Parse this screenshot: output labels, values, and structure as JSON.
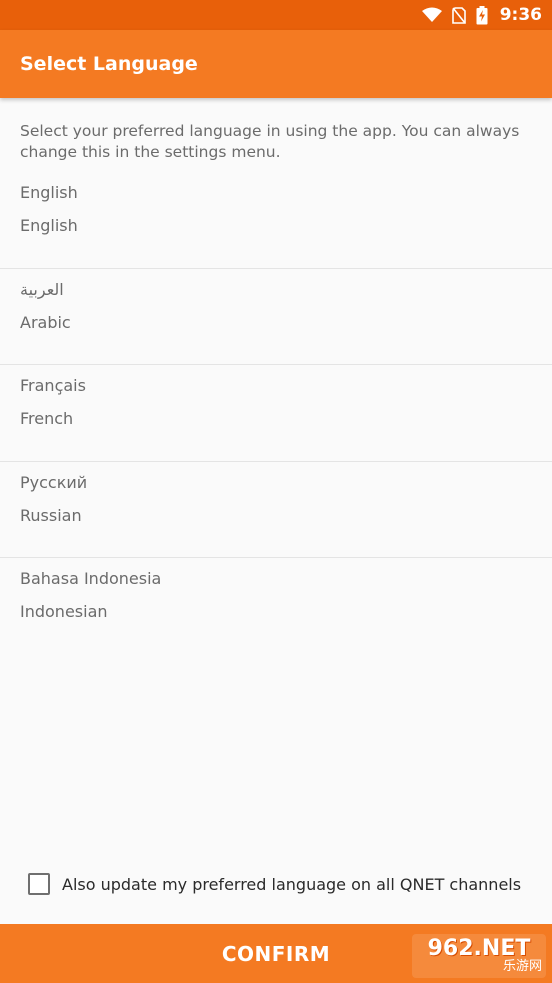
{
  "status_bar": {
    "time": "9:36",
    "icons": [
      "wifi-icon",
      "no-sim-icon",
      "battery-charging-icon"
    ]
  },
  "app_bar": {
    "title": "Select Language"
  },
  "intro_text": "Select your preferred language in using the app. You can always change this in the settings menu.",
  "languages": [
    {
      "native": "English",
      "english": "English"
    },
    {
      "native": "العربية",
      "english": "Arabic"
    },
    {
      "native": "Français",
      "english": "French"
    },
    {
      "native": "Русский",
      "english": "Russian"
    },
    {
      "native": "Bahasa Indonesia",
      "english": "Indonesian"
    }
  ],
  "footer": {
    "checkbox_label": "Also update my preferred language on all QNET channels",
    "checkbox_checked": false,
    "confirm_label": "CONFIRM"
  },
  "watermark": {
    "top": "962.NET",
    "bottom": "乐游网"
  },
  "colors": {
    "status_bar": "#e8600a",
    "primary": "#f47a22",
    "text": "#6b6b6b"
  }
}
